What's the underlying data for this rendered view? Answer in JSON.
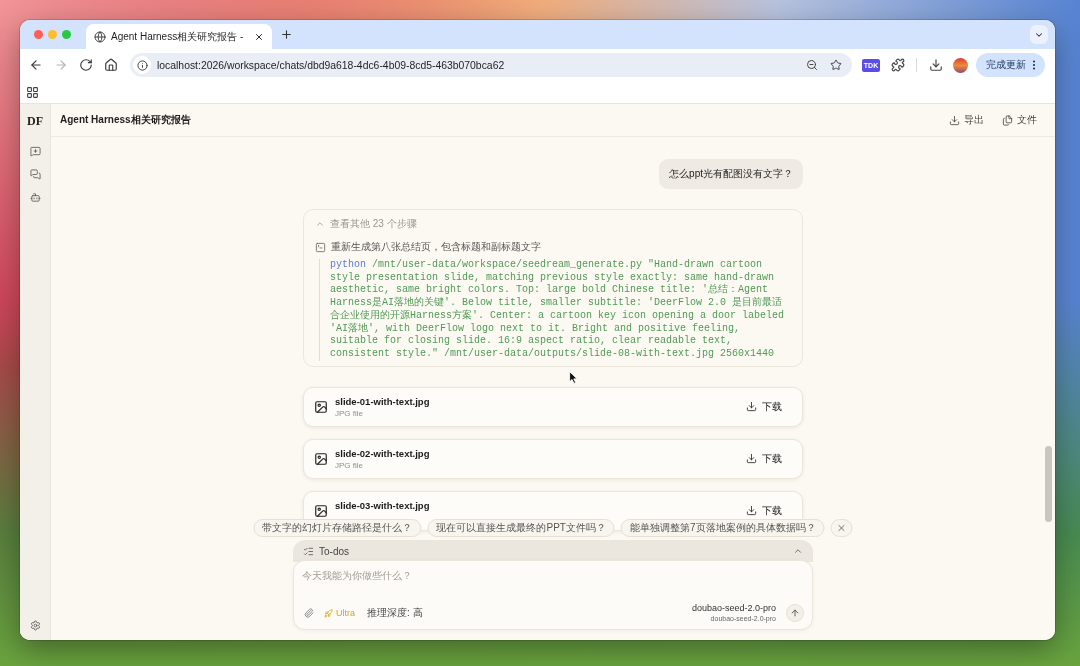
{
  "browser": {
    "tabs": [
      {
        "title": "Agent Harness相关研究报告 -",
        "selected": true
      }
    ],
    "navigation": [
      {
        "kind": "back",
        "disabled": false
      },
      {
        "kind": "forward",
        "disabled": true
      },
      {
        "kind": "reload",
        "disabled": false
      },
      {
        "kind": "home",
        "disabled": false
      }
    ],
    "address": "localhost:2026/workspace/chats/dbd9a618-4dc6-4b09-8cd5-463b070bca62",
    "extension_label": "TDK",
    "update_button": "完成更新"
  },
  "app": {
    "logo": "DF",
    "title": "Agent Harness相关研究报告",
    "header_actions": [
      {
        "kind": "export",
        "label": "导出"
      },
      {
        "kind": "files",
        "label": "文件"
      }
    ]
  },
  "chat": {
    "messages": [
      {
        "kind": "user",
        "text": "怎么ppt光有配图没有文字？"
      }
    ],
    "steps": {
      "summary": "查看其他 23 个步骤",
      "expanded": true,
      "items": [
        {
          "kind": "terminal",
          "title": "重新生成第八张总结页，包含标题和副标题文字",
          "command": "python",
          "arguments": "/mnt/user-data/workspace/seedream_generate.py \"Hand-drawn cartoon style presentation slide, matching previous style exactly: same hand-drawn aesthetic, same bright colors. Top: large bold Chinese title: '总结：Agent Harness是AI落地的关键'. Below title, smaller subtitle: 'DeerFlow 2.0 是目前最适合企业使用的开源Harness方案'. Center: a cartoon key icon opening a door labeled 'AI落地', with DeerFlow logo next to it. Bright and positive feeling, suitable for closing slide. 16:9 aspect ratio, clear readable text, consistent style.\" /mnt/user-data/outputs/slide-08-with-text.jpg 2560x1440"
        }
      ]
    },
    "files": [
      {
        "name": "slide-01-with-text.jpg",
        "type": "JPG file",
        "action": "下载"
      },
      {
        "name": "slide-02-with-text.jpg",
        "type": "JPG file",
        "action": "下载"
      },
      {
        "name": "slide-03-with-text.jpg",
        "action": "下载"
      }
    ],
    "suggestions": [
      "带文字的幻灯片存储路径是什么？",
      "现在可以直接生成最终的PPT文件吗？",
      "能单独调整第7页落地案例的具体数据吗？"
    ]
  },
  "composer": {
    "todos": {
      "label": "To-dos",
      "expanded": false
    },
    "placeholder": "今天我能为你做些什么？",
    "mode": "Ultra",
    "reasoning": "推理深度: 高",
    "model": "doubao-seed-2.0-pro",
    "model_detail": "doubao-seed-2.0-pro"
  }
}
